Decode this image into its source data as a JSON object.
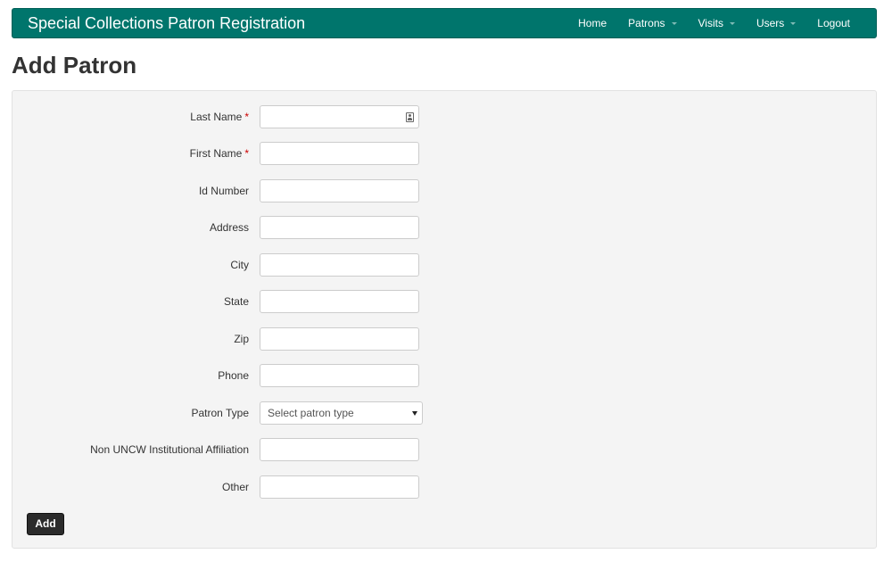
{
  "navbar": {
    "brand": "Special Collections Patron Registration",
    "items": [
      {
        "label": "Home",
        "dropdown": false
      },
      {
        "label": "Patrons",
        "dropdown": true
      },
      {
        "label": "Visits",
        "dropdown": true
      },
      {
        "label": "Users",
        "dropdown": true
      },
      {
        "label": "Logout",
        "dropdown": false
      }
    ]
  },
  "page": {
    "title": "Add Patron"
  },
  "form": {
    "required_marker": "*",
    "fields": [
      {
        "label": "Last Name",
        "value": "",
        "required": true
      },
      {
        "label": "First Name",
        "value": "",
        "required": true
      },
      {
        "label": "Id Number",
        "value": ""
      },
      {
        "label": "Address",
        "value": ""
      },
      {
        "label": "City",
        "value": ""
      },
      {
        "label": "State",
        "value": ""
      },
      {
        "label": "Zip",
        "value": ""
      },
      {
        "label": "Phone",
        "value": ""
      },
      {
        "label": "Patron Type",
        "type": "select",
        "selected": "Select patron type"
      },
      {
        "label": "Non UNCW Institutional Affiliation",
        "value": ""
      },
      {
        "label": "Other",
        "value": ""
      }
    ],
    "submit_label": "Add"
  },
  "colors": {
    "navbar_bg": "#00756c",
    "required": "#cc0000",
    "button_bg": "#2b2b2b"
  }
}
